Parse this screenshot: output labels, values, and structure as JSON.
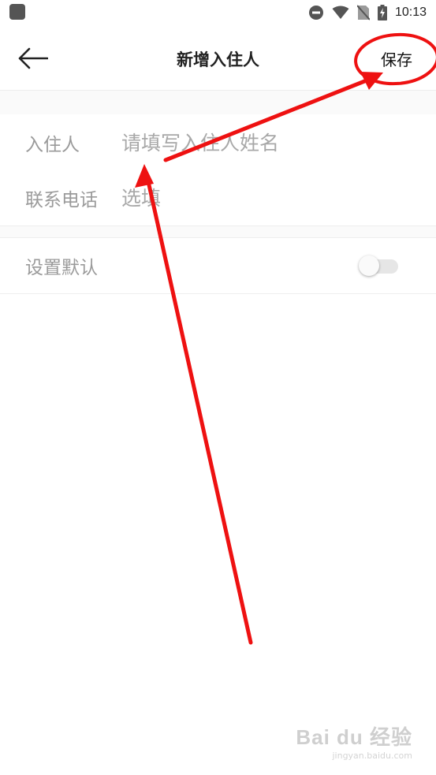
{
  "status_bar": {
    "time": "10:13"
  },
  "header": {
    "title": "新增入住人",
    "save_label": "保存"
  },
  "form": {
    "guest_name": {
      "label": "入住人",
      "placeholder": "请填写入住人姓名",
      "value": ""
    },
    "phone": {
      "label": "联系电话",
      "placeholder": "选填",
      "value": ""
    },
    "set_default": {
      "label": "设置默认",
      "enabled": false
    }
  },
  "annotation_color": "#ee1111",
  "watermark": {
    "main": "Bai du 经验",
    "sub": "jingyan.baidu.com"
  }
}
